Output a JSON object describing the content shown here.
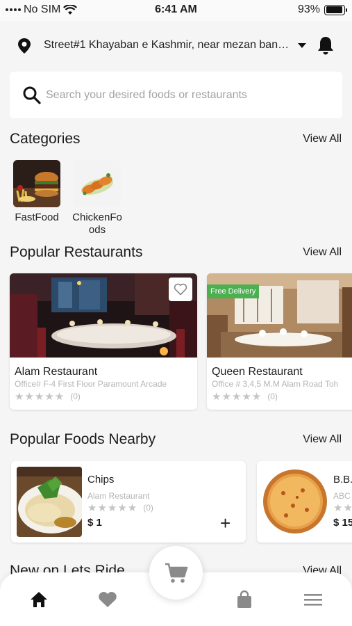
{
  "status_bar": {
    "carrier": "No SIM",
    "time": "6:41 AM",
    "battery": "93%",
    "battery_level": 0.93
  },
  "location": {
    "address": "Street#1 Khayaban e Kashmir, near mezan bank..."
  },
  "search": {
    "placeholder": "Search your desired foods or restaurants"
  },
  "categories": {
    "title": "Categories",
    "view_all": "View All",
    "items": [
      {
        "label": "FastFood"
      },
      {
        "label": "ChickenFoods"
      }
    ]
  },
  "popular_restaurants": {
    "title": "Popular Restaurants",
    "view_all": "View All",
    "items": [
      {
        "name": "Alam Restaurant",
        "address": "Office# F-4 First Floor Paramount Arcade",
        "rating_count": "(0)",
        "stars": 0
      },
      {
        "name": "Queen Restaurant",
        "address": "Office # 3,4,5 M.M Alam Road Toh",
        "rating_count": "(0)",
        "stars": 0,
        "badge": "Free Delivery"
      }
    ]
  },
  "popular_foods": {
    "title": "Popular Foods Nearby",
    "view_all": "View All",
    "items": [
      {
        "name": "Chips",
        "restaurant": "Alam Restaurant",
        "rating_count": "(0)",
        "price": "$ 1",
        "add": "+"
      },
      {
        "name": "B.B.",
        "restaurant": "ABC",
        "rating_count": "",
        "price": "$ 15"
      }
    ]
  },
  "new_section": {
    "title": "New on Lets Ride",
    "view_all": "View All"
  },
  "icons": {
    "location": "location-pin-icon",
    "notification": "bell-icon",
    "search": "search-icon",
    "favorite": "heart-icon",
    "cart": "cart-icon",
    "home": "home-icon",
    "orders": "shopping-bag-icon",
    "menu": "menu-icon"
  },
  "colors": {
    "badge": "#4caf50",
    "nav_active": "#111111",
    "nav_inactive": "#8a8a8a"
  }
}
